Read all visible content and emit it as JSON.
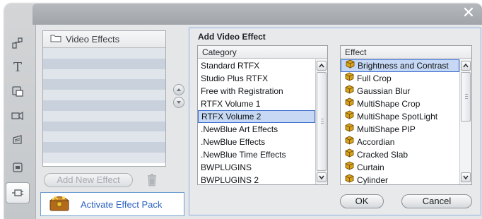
{
  "window": {
    "close_glyph": "✕"
  },
  "sidebar": {
    "items": [
      {
        "icon": "image-tools-icon"
      },
      {
        "icon": "title-text-icon",
        "glyph": "T"
      },
      {
        "icon": "transitions-icon"
      },
      {
        "icon": "camera-effects-icon"
      },
      {
        "icon": "sound-effects-icon"
      },
      {
        "icon": "menu-icon"
      },
      {
        "icon": "effects-icon",
        "active": true
      }
    ]
  },
  "effects_panel": {
    "title": "Video Effects",
    "row_count": 11,
    "add_new_label": "Add New Effect",
    "activate_label": "Activate Effect Pack"
  },
  "add_dialog": {
    "title": "Add Video Effect",
    "category_header": "Category",
    "effect_header": "Effect",
    "categories": [
      "Standard RTFX",
      "Studio Plus RTFX",
      "Free with Registration",
      "RTFX Volume 1",
      "RTFX Volume 2",
      ".NewBlue Art Effects",
      ".NewBlue Effects",
      ".NewBlue Time Effects",
      "BWPLUGINS",
      "BWPLUGINS 2"
    ],
    "selected_category": "RTFX Volume 2",
    "effects": [
      "Brightness and Contrast",
      "Full Crop",
      "Gaussian Blur",
      "MultiShape Crop",
      "MultiShape SpotLight",
      "MultiShape PIP",
      "Accordian",
      "Cracked Slab",
      "Curtain",
      "Cylinder"
    ],
    "selected_effect": "Brightness and Contrast",
    "ok_label": "OK",
    "cancel_label": "Cancel"
  },
  "colors": {
    "selection_fill": "#c6d8f3",
    "selection_border": "#3d6fd0",
    "link_blue": "#2c62c2",
    "effect_icon": "#d9a21b"
  }
}
